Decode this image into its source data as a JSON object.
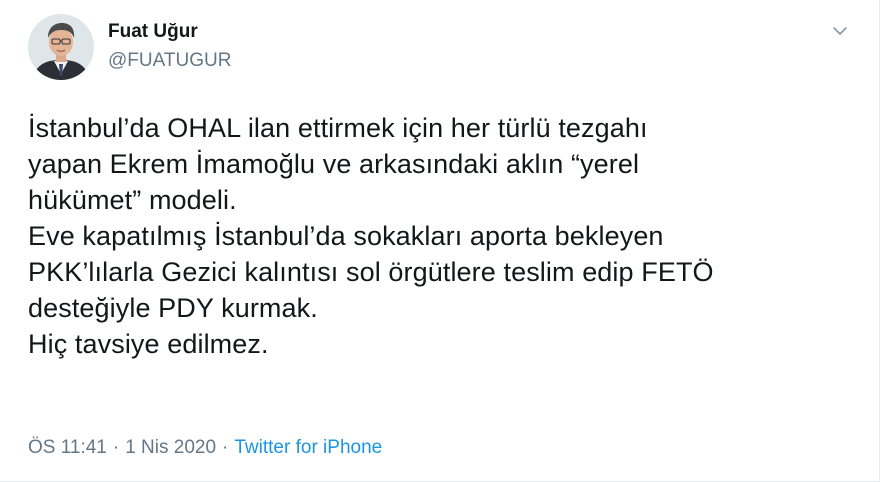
{
  "user": {
    "display_name": "Fuat Uğur",
    "handle": "@FUATUGUR"
  },
  "tweet": {
    "lines": [
      "İstanbul’da OHAL ilan ettirmek için her türlü tezgahı",
      "yapan Ekrem İmamoğlu ve arkasındaki aklın “yerel",
      "hükümet” modeli.",
      "Eve kapatılmış İstanbul’da sokakları aporta bekleyen",
      "PKK’lılarla Gezici kalıntısı sol örgütlere teslim edip FETÖ",
      "desteğiyle PDY kurmak.",
      "Hiç tavsiye edilmez."
    ]
  },
  "meta": {
    "time": "ÖS 11:41",
    "separator": "·",
    "date": "1 Nis 2020",
    "source": "Twitter for iPhone"
  },
  "icons": {
    "menu": "chevron-down-icon"
  },
  "colors": {
    "text": "#14171a",
    "secondary": "#657786",
    "link": "#1b95e0"
  }
}
